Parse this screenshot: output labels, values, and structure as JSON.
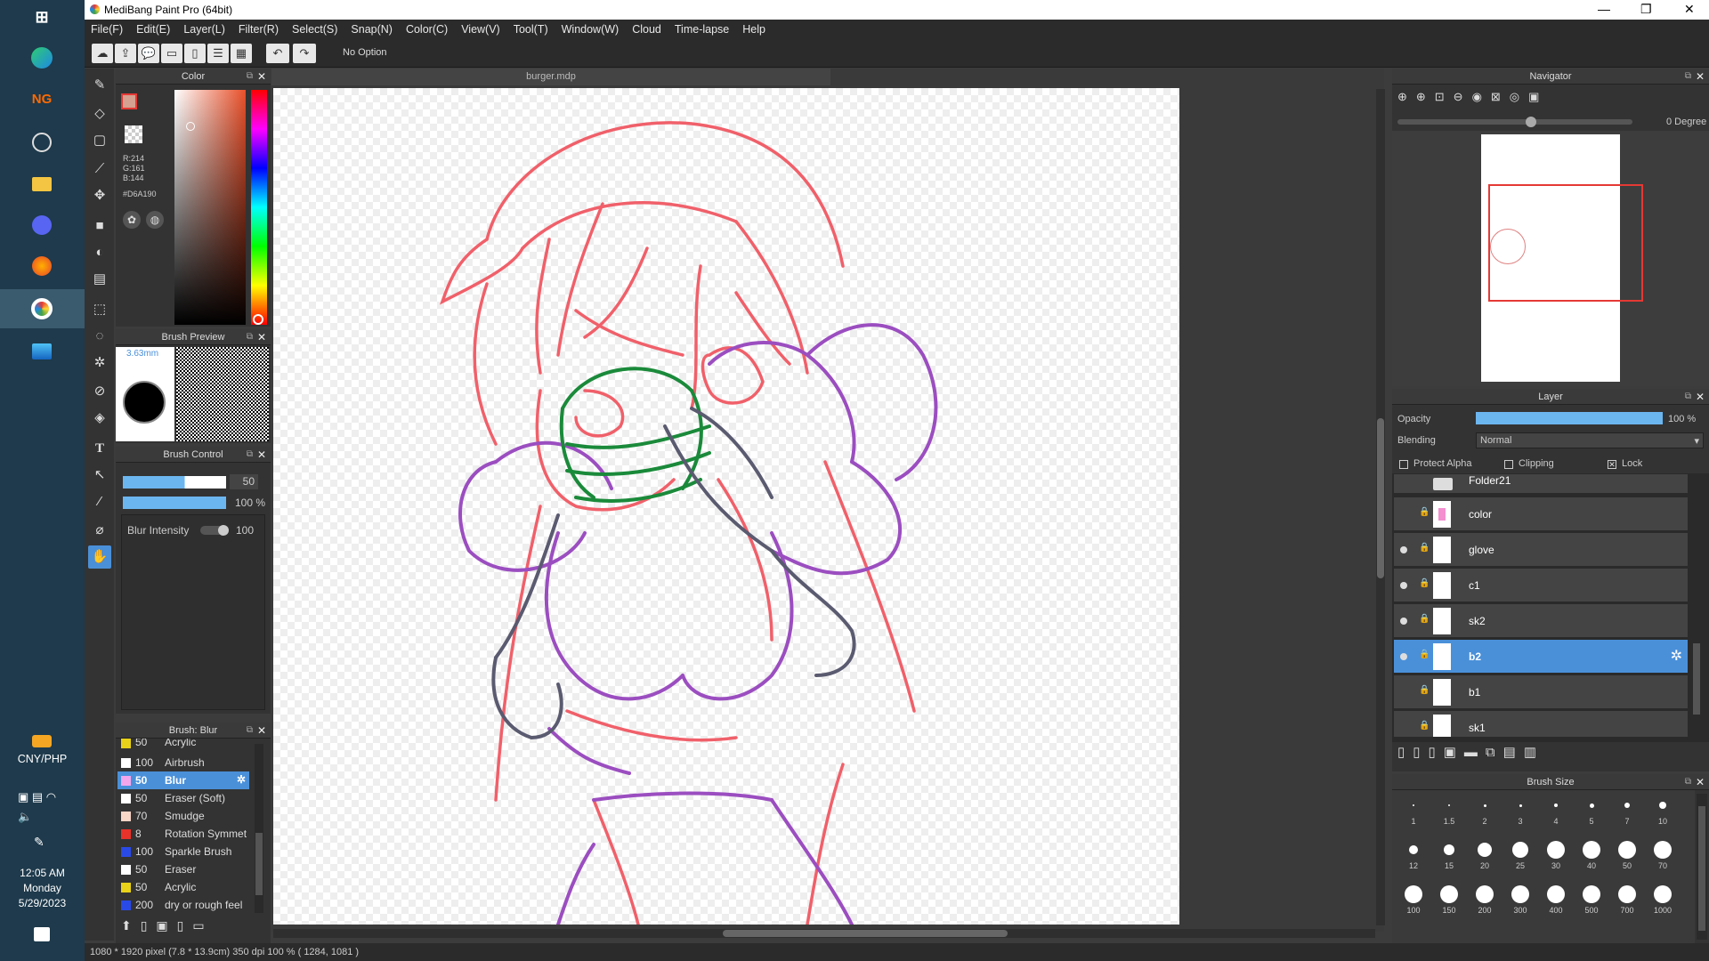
{
  "window": {
    "title": "MediBang Paint Pro (64bit)"
  },
  "menu": [
    "File(F)",
    "Edit(E)",
    "Layer(L)",
    "Filter(R)",
    "Select(S)",
    "Snap(N)",
    "Color(C)",
    "View(V)",
    "Tool(T)",
    "Window(W)",
    "Cloud",
    "Time-lapse",
    "Help"
  ],
  "toolbar": {
    "option_label": "No Option"
  },
  "document": {
    "tab": "burger.mdp"
  },
  "color_panel": {
    "title": "Color",
    "r": "R:214",
    "g": "G:161",
    "b": "B:144",
    "hex": "#D6A190"
  },
  "brush_preview": {
    "title": "Brush Preview",
    "size": "3.63mm"
  },
  "brush_control": {
    "title": "Brush Control",
    "size_value": "50",
    "opacity_value": "100 %",
    "blur_label": "Blur Intensity",
    "blur_value": "100"
  },
  "brush_list": {
    "title": "Brush: Blur",
    "items": [
      {
        "size": "50",
        "name": "Acrylic",
        "color": "#e8d21a"
      },
      {
        "size": "100",
        "name": "Airbrush",
        "color": "#ffffff"
      },
      {
        "size": "50",
        "name": "Blur",
        "color": "#f4a6ec"
      },
      {
        "size": "50",
        "name": "Eraser (Soft)",
        "color": "#ffffff"
      },
      {
        "size": "70",
        "name": "Smudge",
        "color": "#f8d6c8"
      },
      {
        "size": "8",
        "name": "Rotation Symmet",
        "color": "#e8322a"
      },
      {
        "size": "100",
        "name": "Sparkle Brush",
        "color": "#2a4ae8"
      },
      {
        "size": "50",
        "name": "Eraser",
        "color": "#ffffff"
      },
      {
        "size": "50",
        "name": "Acrylic",
        "color": "#e8d21a"
      },
      {
        "size": "200",
        "name": "dry or rough feel",
        "color": "#2a4ae8"
      }
    ]
  },
  "navigator": {
    "title": "Navigator",
    "rotation": "0 Degree"
  },
  "layer_panel": {
    "title": "Layer",
    "opacity_label": "Opacity",
    "opacity_value": "100 %",
    "blending_label": "Blending",
    "blending_value": "Normal",
    "protect_alpha": "Protect Alpha",
    "clipping": "Clipping",
    "lock": "Lock",
    "layers": [
      {
        "name": "Folder21"
      },
      {
        "name": "color"
      },
      {
        "name": "glove"
      },
      {
        "name": "c1"
      },
      {
        "name": "sk2"
      },
      {
        "name": "b2"
      },
      {
        "name": "b1"
      },
      {
        "name": "sk1"
      }
    ]
  },
  "brush_size": {
    "title": "Brush Size",
    "sizes": [
      "1",
      "1.5",
      "2",
      "3",
      "4",
      "5",
      "7",
      "10",
      "12",
      "15",
      "20",
      "25",
      "30",
      "40",
      "50",
      "70",
      "100",
      "150",
      "200",
      "300",
      "400",
      "500",
      "700",
      "1000"
    ]
  },
  "status": {
    "text": "1080 * 1920 pixel   (7.8 * 13.9cm)   350 dpi   100 %   ( 1284, 1081 )"
  },
  "taskbar": {
    "currency": "CNY/PHP",
    "time": "12:05 AM",
    "day": "Monday",
    "date": "5/29/2023",
    "ng_label": "NG"
  }
}
